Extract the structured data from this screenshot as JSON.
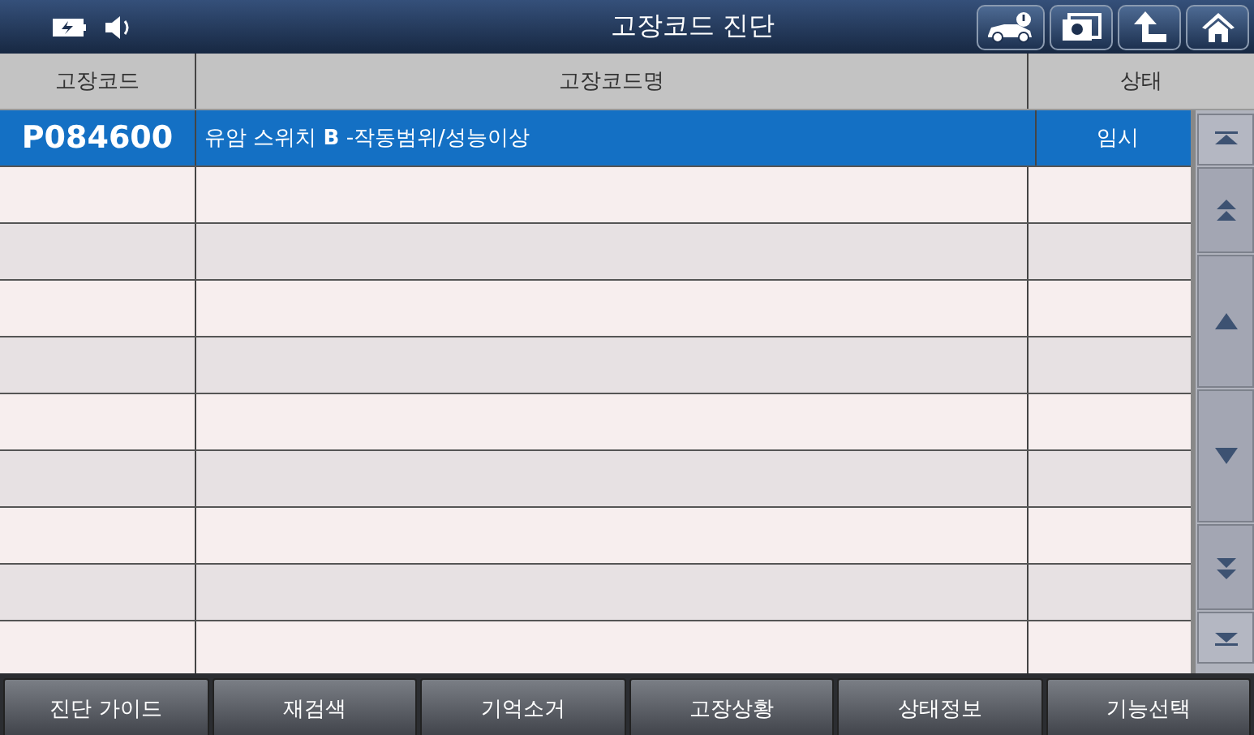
{
  "window": {
    "title": "고장코드 진단"
  },
  "table": {
    "columns": [
      "고장코드",
      "고장코드명",
      "상태"
    ],
    "rows": [
      {
        "code": "P084600",
        "name": "유암 스위치 **B** -작동범위/성능이상",
        "status": "임시",
        "selected": true
      }
    ]
  },
  "footer_buttons": [
    "진단 가이드",
    "재검색",
    "기억소거",
    "고장상황",
    "상태정보",
    "기능선택"
  ]
}
